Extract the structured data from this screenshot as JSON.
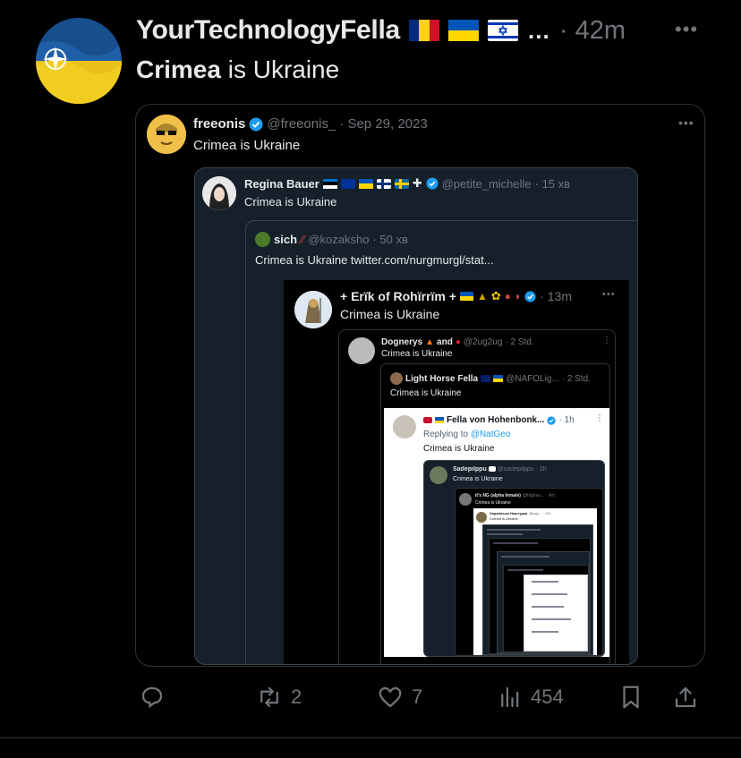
{
  "main_tweet": {
    "display_name": "YourTechnologyFella",
    "name_suffix": "…",
    "time": "· 42m",
    "text_bold": "Crimea",
    "text_rest": " is Ukraine",
    "flag_colors": [
      [
        "#002b7f",
        "#fcd116",
        "#ce1126"
      ],
      [
        "#0057b7",
        "#ffd700"
      ],
      [
        "#ffffff",
        "#0038b8"
      ]
    ]
  },
  "quote1": {
    "display_name": "freeonis",
    "handle": "@freeonis_",
    "date": "· Sep 29, 2023",
    "text": "Crimea is Ukraine"
  },
  "quote2": {
    "display_name": "Regina Bauer",
    "handle": "@petite_michelle",
    "time": "· 15 хв",
    "text": "Crimea is Ukraine"
  },
  "quote3": {
    "display_name": "sich",
    "handle": "@kozaksho",
    "time": "· 50 хв",
    "text": "Crimea is Ukraine  twitter.com/nurgmurgl/stat..."
  },
  "quote4": {
    "display_name": "+ Erïk of Rohïrrïm +",
    "time": "· 13m",
    "text": "Crimea is Ukraine"
  },
  "quote5": {
    "display_name": "Dognerys",
    "name_mid": "and",
    "handle": "@2ug2ug",
    "time": "· 2 Std.",
    "text": "Crimea is Ukraine"
  },
  "quote6": {
    "display_name": "Light Horse Fella",
    "handle": "@NAFOLig...",
    "time": "· 2 Std.",
    "text": "Crimea is Ukraine"
  },
  "quote7": {
    "display_name": "Fella von Hohenbonk...",
    "time": "· 1h",
    "replying_prefix": "Replying to ",
    "replying_handle": "@NatGeo",
    "text": "Crimea is Ukraine"
  },
  "quote8": {
    "display_name": "Sadepilppu",
    "handle": "@sadepilppu",
    "time": "· 2h",
    "text": "Crimea is Ukraine"
  },
  "quote9": {
    "display_name": "it's NG (alpha female)",
    "handle": "@highsa...",
    "time": "· 4m",
    "text": "Crimea is Ukraine"
  },
  "quote10": {
    "display_name": "Харківська Наштурка",
    "handle": "@nay...",
    "time": "· 11h",
    "text": "Crimea is Ukraine."
  },
  "actions": {
    "retweets": "2",
    "likes": "7",
    "views": "454"
  },
  "colors": {
    "accent": "#1d9bf0",
    "muted": "#71767b"
  }
}
